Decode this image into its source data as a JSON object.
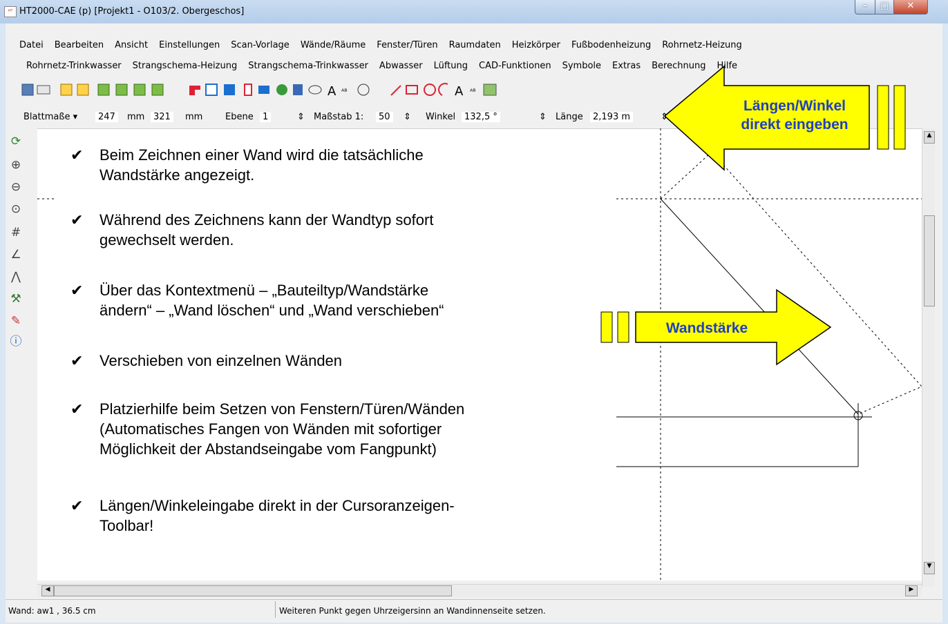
{
  "window": {
    "title": "HT2000-CAE (p)  [Projekt1 - O103/2. Obergeschos]",
    "app_icon": "app-icon",
    "controls": {
      "minimize": "–",
      "maximize": "□",
      "close": "✕"
    }
  },
  "menu": {
    "row1": [
      "Datei",
      "Bearbeiten",
      "Ansicht",
      "Einstellungen",
      "Scan-Vorlage",
      "Wände/Räume",
      "Fenster/Türen",
      "Raumdaten",
      "Heizkörper",
      "Fußbodenheizung",
      "Rohrnetz-Heizung"
    ],
    "row2": [
      "Rohrnetz-Trinkwasser",
      "Strangschema-Heizung",
      "Strangschema-Trinkwasser",
      "Abwasser",
      "Lüftung",
      "CAD-Funktionen",
      "Symbole",
      "Extras",
      "Berechnung",
      "Hilfe"
    ]
  },
  "cursorbar": {
    "blattmasse_label": "Blattmaße ▾",
    "width_value": "247",
    "width_unit": "mm",
    "height_value": "321",
    "height_unit": "mm",
    "ebene_label": "Ebene",
    "ebene_value": "1",
    "massstab_label": "Maßstab 1:",
    "massstab_value": "50",
    "winkel_label": "Winkel",
    "winkel_value": "132,5 °",
    "laenge_label": "Länge",
    "laenge_value": "2,193 m"
  },
  "content": {
    "bullets": [
      "Beim Zeichnen einer Wand wird die tatsächliche\nWandstärke angezeigt.",
      "Während des Zeichnens kann der Wandtyp sofort\ngewechselt werden.",
      "Über das Kontextmenü – „Bauteiltyp/Wandstärke\nändern“ – „Wand löschen“ und „Wand verschieben“",
      "Verschieben von einzelnen Wänden",
      "Platzierhilfe beim Setzen von Fenstern/Türen/Wänden\n(Automatisches Fangen von Wänden mit sofortiger\nMöglichkeit der Abstandseingabe vom Fangpunkt)",
      "Längen/Winkeleingabe direkt in der Cursoranzeigen-\nToolbar!"
    ],
    "check_glyph": "✔"
  },
  "annotations": {
    "arrow_top": "Längen/Winkel\ndirekt eingeben",
    "arrow_mid": "Wandstärke"
  },
  "status": {
    "left": "Wand: aw1  , 36.5 cm",
    "right": "Weiteren Punkt gegen Uhrzeigersinn an Wandinnenseite setzen."
  },
  "colors": {
    "arrow_fill": "#ffff00",
    "arrow_text": "#2040c0",
    "titlebar": "#c1d6ee"
  }
}
